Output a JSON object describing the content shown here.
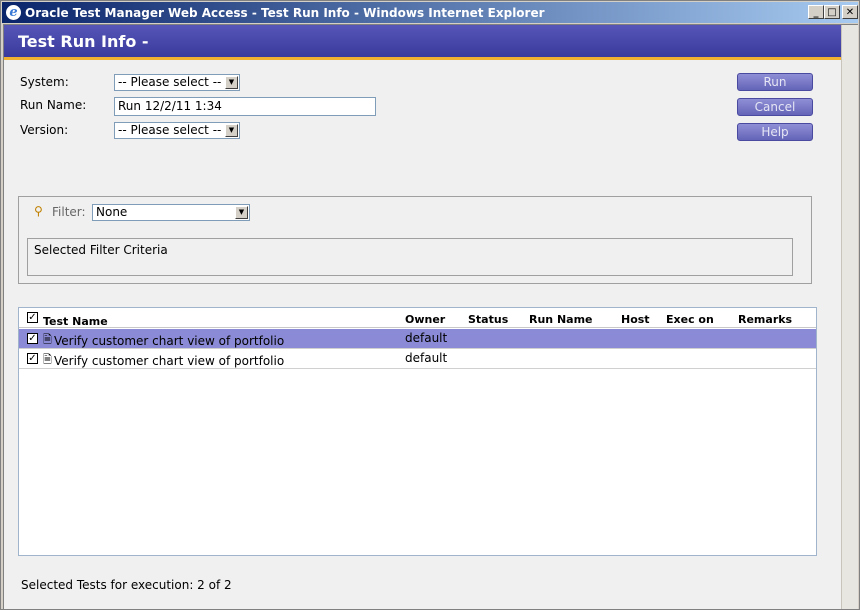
{
  "window": {
    "title": "Oracle Test Manager Web Access - Test Run Info - Windows Internet Explorer",
    "minimize": "_",
    "maximize": "□",
    "close": "✕"
  },
  "header": {
    "title": "Test Run Info -"
  },
  "form": {
    "system_label": "System:",
    "system_value": "-- Please select --",
    "run_name_label": "Run Name:",
    "run_name_value": "Run 12/2/11 1:34",
    "version_label": "Version:",
    "version_value": "-- Please select --"
  },
  "buttons": {
    "run": "Run",
    "cancel": "Cancel",
    "help": "Help"
  },
  "filter": {
    "label": "Filter:",
    "value": "None",
    "criteria_label": "Selected Filter Criteria"
  },
  "grid": {
    "columns": [
      "Test Name",
      "Owner",
      "Status",
      "Run Name",
      "Host",
      "Exec on",
      "Remarks"
    ],
    "rows": [
      {
        "checked": true,
        "name": "Verify customer chart view of portfolio",
        "owner": "default",
        "selected": true
      },
      {
        "checked": true,
        "name": "Verify customer chart view of portfolio",
        "owner": "default",
        "selected": false
      }
    ]
  },
  "footer": {
    "selected_text": "Selected Tests for execution: 2 of 2"
  },
  "colors": {
    "header_band": "#3a3a9c",
    "accent_bar": "#f0b030",
    "row_selected": "#8a8ad6"
  }
}
